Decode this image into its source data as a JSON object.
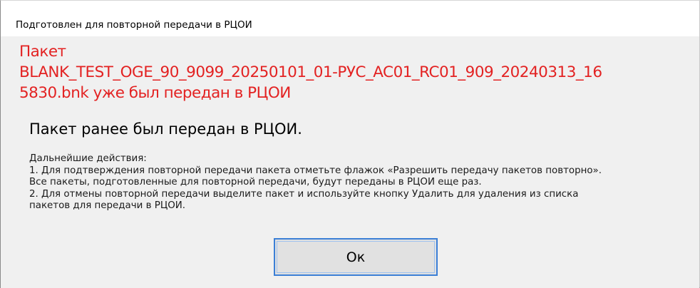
{
  "dialog": {
    "title": "Подготовлен для повторной передачи в РЦОИ",
    "error_lines": [
      "Пакет",
      "BLANK_TEST_OGE_90_9099_20250101_01-РУС_AC01_RC01_909_20240313_16",
      "5830.bnk уже был передан в РЦОИ"
    ],
    "heading": "Пакет ранее был передан в РЦОИ.",
    "instructions": [
      "Дальнейшие действия:",
      "1. Для подтверждения повторной передачи пакета отметьте флажок «Разрешить передачу пакетов повторно».",
      "Все пакеты, подготовленные для повторной передачи, будут переданы в РЦОИ еще раз.",
      "2. Для отмены повторной передачи выделите пакет и используйте кнопку Удалить для удаления из списка",
      "пакетов для передачи в РЦОИ."
    ],
    "ok_label": "Ок"
  },
  "colors": {
    "error_text": "#e32222",
    "content_background": "#f0f0f0",
    "title_background": "#ffffff",
    "button_border": "#3b7fd6",
    "button_background": "#e1e1e1"
  }
}
